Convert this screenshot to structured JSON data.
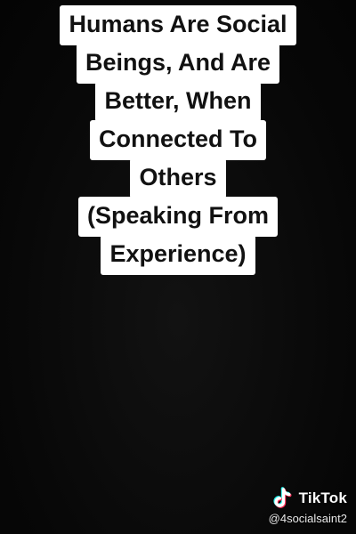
{
  "caption": {
    "lines": [
      "Humans Are Social",
      "Beings, And Are",
      "Better, When",
      "Connected To",
      "Others",
      "(Speaking From",
      "Experience)"
    ]
  },
  "watermark": {
    "brand": "TikTok",
    "handle": "@4socialsaint2",
    "icon": "tiktok-logo-icon"
  },
  "colors": {
    "background": "#0a0a0a",
    "caption_bg": "#ffffff",
    "caption_text": "#111111",
    "logo_cyan": "#25f4ee",
    "logo_red": "#fe2c55"
  }
}
